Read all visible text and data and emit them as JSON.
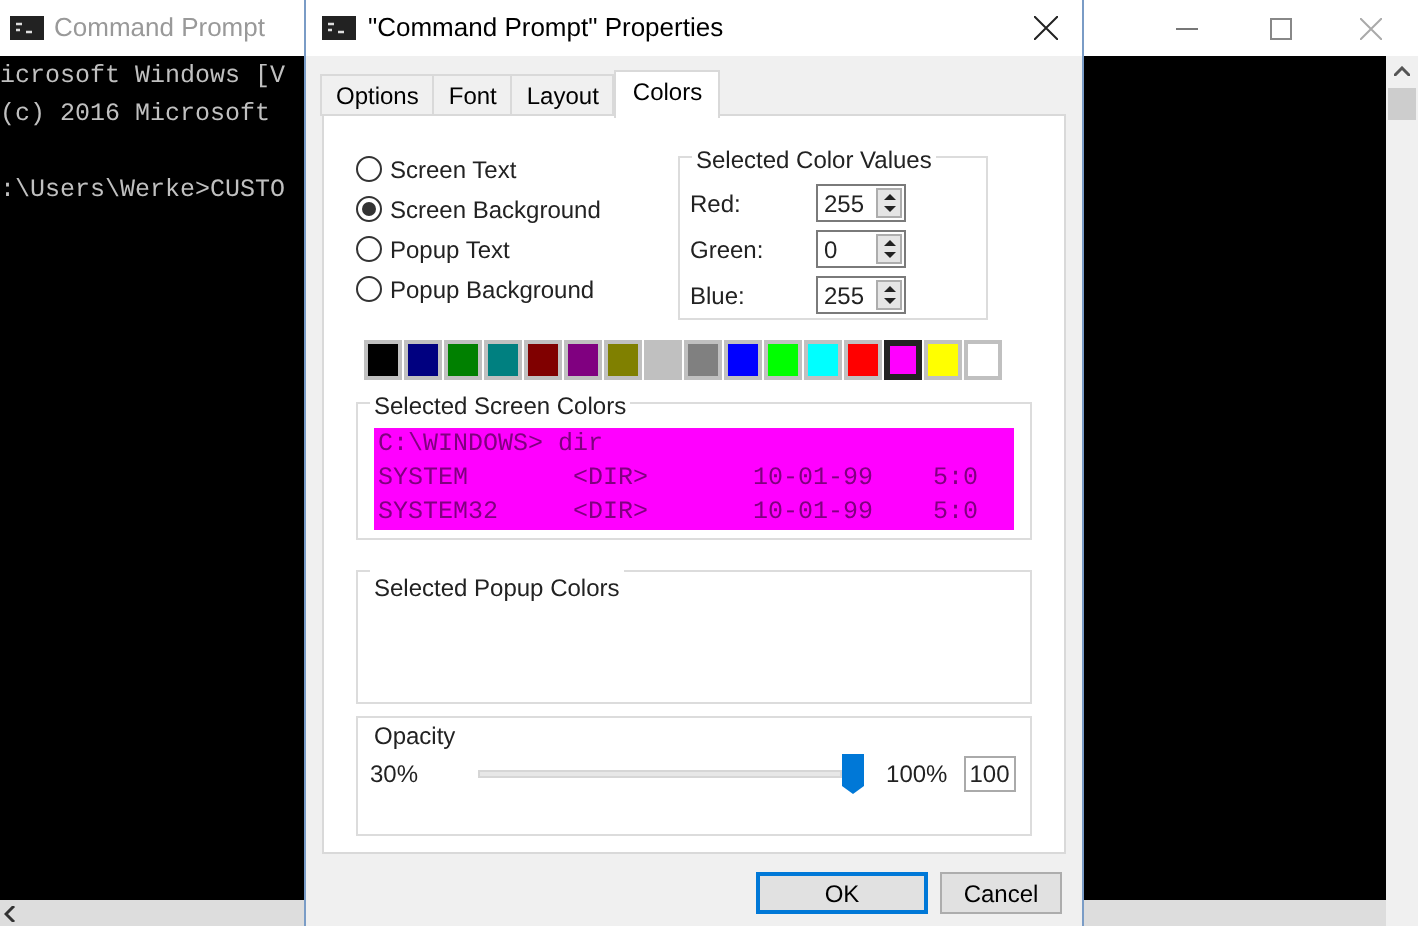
{
  "console": {
    "title": "Command Prompt",
    "paragraphs": [
      [
        "icrosoft Windows [V",
        "(c) 2016 Microsoft"
      ],
      [
        ":\\Users\\Werke>CUSTO"
      ]
    ]
  },
  "dialog": {
    "title": "\"Command Prompt\" Properties",
    "tabs": [
      {
        "label": "Options",
        "selected": false
      },
      {
        "label": "Font",
        "selected": false
      },
      {
        "label": "Layout",
        "selected": false
      },
      {
        "label": "Colors",
        "selected": true
      }
    ],
    "radios": [
      {
        "label": "Screen Text",
        "selected": false
      },
      {
        "label": "Screen Background",
        "selected": true
      },
      {
        "label": "Popup Text",
        "selected": false
      },
      {
        "label": "Popup Background",
        "selected": false
      }
    ],
    "color_values": {
      "title": "Selected Color Values",
      "fields": [
        {
          "label": "Red:",
          "value": "255"
        },
        {
          "label": "Green:",
          "value": "0"
        },
        {
          "label": "Blue:",
          "value": "255"
        }
      ]
    },
    "swatches": [
      {
        "color": "#000000",
        "selected": false
      },
      {
        "color": "#000080",
        "selected": false
      },
      {
        "color": "#008000",
        "selected": false
      },
      {
        "color": "#008080",
        "selected": false
      },
      {
        "color": "#800000",
        "selected": false
      },
      {
        "color": "#800080",
        "selected": false
      },
      {
        "color": "#808000",
        "selected": false
      },
      {
        "color": "#c0c0c0",
        "selected": false
      },
      {
        "color": "#808080",
        "selected": false
      },
      {
        "color": "#0000ff",
        "selected": false
      },
      {
        "color": "#00ff00",
        "selected": false
      },
      {
        "color": "#00ffff",
        "selected": false
      },
      {
        "color": "#ff0000",
        "selected": false
      },
      {
        "color": "#ff00ff",
        "selected": true
      },
      {
        "color": "#ffff00",
        "selected": false
      },
      {
        "color": "#ffffff",
        "selected": false
      }
    ],
    "screen_colors": {
      "title": "Selected Screen Colors",
      "lines": [
        "C:\\WINDOWS> dir",
        "SYSTEM       <DIR>       10-01-99    5:0",
        "SYSTEM32     <DIR>       10-01-99    5:0"
      ]
    },
    "popup_colors": {
      "title": "Selected Popup Colors"
    },
    "opacity": {
      "title": "Opacity",
      "min": "30%",
      "max": "100%",
      "level": 1,
      "value": "100"
    },
    "buttons": [
      {
        "label": "OK",
        "default": true
      },
      {
        "label": "Cancel",
        "default": false
      }
    ]
  }
}
